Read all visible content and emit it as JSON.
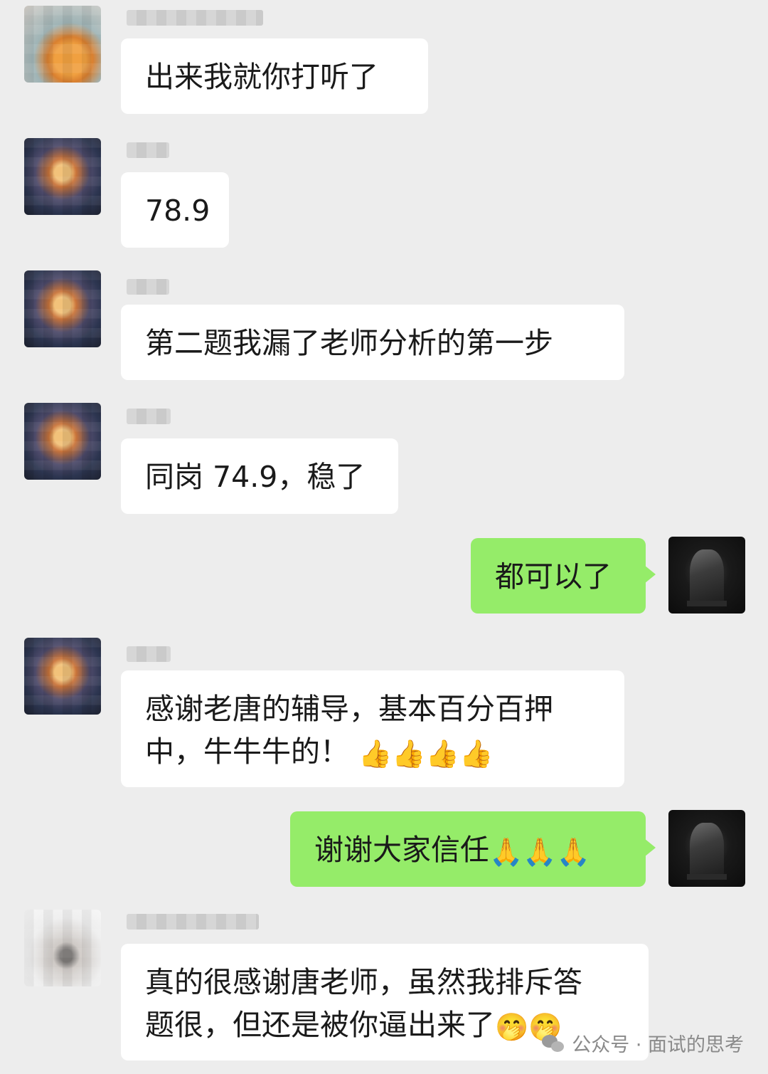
{
  "messages": [
    {
      "side": "left",
      "name": "静默",
      "text": "出来我就你打听了"
    },
    {
      "side": "left",
      "name": "静默",
      "text": "78.9"
    },
    {
      "side": "left",
      "name": "",
      "text": "第二题我漏了老师分析的第一步"
    },
    {
      "side": "left",
      "name": "静默",
      "text": "同岗 74.9，稳了"
    },
    {
      "side": "right",
      "text": "都可以了"
    },
    {
      "side": "left",
      "name": "静默",
      "text": "感谢老唐的辅导，基本百分百押",
      "text2": "中，牛牛牛的！",
      "emoji": "👍👍👍👍"
    },
    {
      "side": "right",
      "text": "谢谢大家信任",
      "emoji": "🙏🙏🙏"
    },
    {
      "side": "left",
      "name": "",
      "text": "真的很感谢唐老师，虽然我排斥答",
      "text2": "题很，但还是被你逼出来了",
      "emoji": "🤭🤭"
    }
  ],
  "watermark": {
    "text": "公众号 · 面试的思考",
    "icon": "wechat-icon"
  },
  "colors": {
    "background": "#ededed",
    "bubble_left": "#ffffff",
    "bubble_right": "#95ec69"
  }
}
